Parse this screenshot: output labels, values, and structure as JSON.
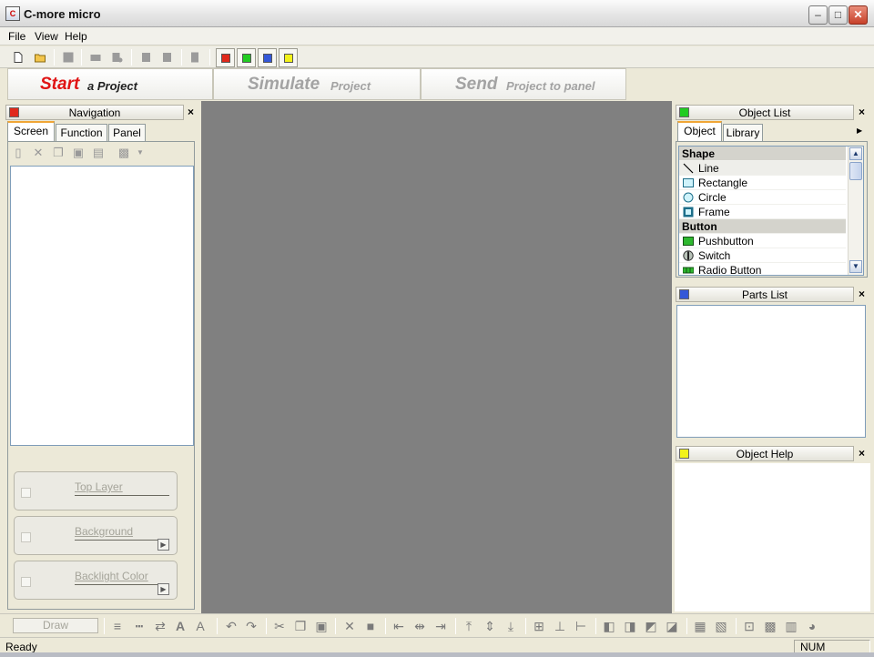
{
  "window": {
    "title": "C-more micro"
  },
  "menu": {
    "items": [
      "File",
      "View",
      "Help"
    ]
  },
  "workflow": {
    "steps": [
      {
        "big": "Start",
        "small": "a Project"
      },
      {
        "big": "Simulate",
        "small": "Project"
      },
      {
        "big": "Send",
        "small": "Project to panel"
      }
    ]
  },
  "colors": {
    "red": "#e0291b",
    "green": "#22cc22",
    "blue": "#3458d8",
    "yellow": "#f2f21a"
  },
  "navigation": {
    "title": "Navigation",
    "tabs": [
      "Screen",
      "Function",
      "Panel"
    ],
    "active_tab": "Screen",
    "properties": [
      {
        "label": "Top Layer",
        "has_arrow": false
      },
      {
        "label": "Background",
        "has_arrow": true
      },
      {
        "label": "Backlight Color",
        "has_arrow": true
      }
    ]
  },
  "object_list": {
    "title": "Object List",
    "tabs": [
      "Object",
      "Library"
    ],
    "active_tab": "Object",
    "rows": [
      {
        "kind": "category",
        "label": "Shape"
      },
      {
        "kind": "item",
        "label": "Line",
        "icon": "line-icon"
      },
      {
        "kind": "item",
        "label": "Rectangle",
        "icon": "rectangle-icon"
      },
      {
        "kind": "item",
        "label": "Circle",
        "icon": "circle-icon"
      },
      {
        "kind": "item",
        "label": "Frame",
        "icon": "frame-icon"
      },
      {
        "kind": "category",
        "label": "Button"
      },
      {
        "kind": "item",
        "label": "Pushbutton",
        "icon": "pushbutton-icon"
      },
      {
        "kind": "item",
        "label": "Switch",
        "icon": "switch-icon"
      },
      {
        "kind": "item",
        "label": "Radio Button",
        "icon": "radio-button-icon"
      }
    ]
  },
  "parts_list": {
    "title": "Parts List"
  },
  "object_help": {
    "title": "Object Help"
  },
  "bottom_toolbar": {
    "draw_label": "Draw"
  },
  "status": {
    "text": "Ready",
    "num": "NUM"
  }
}
